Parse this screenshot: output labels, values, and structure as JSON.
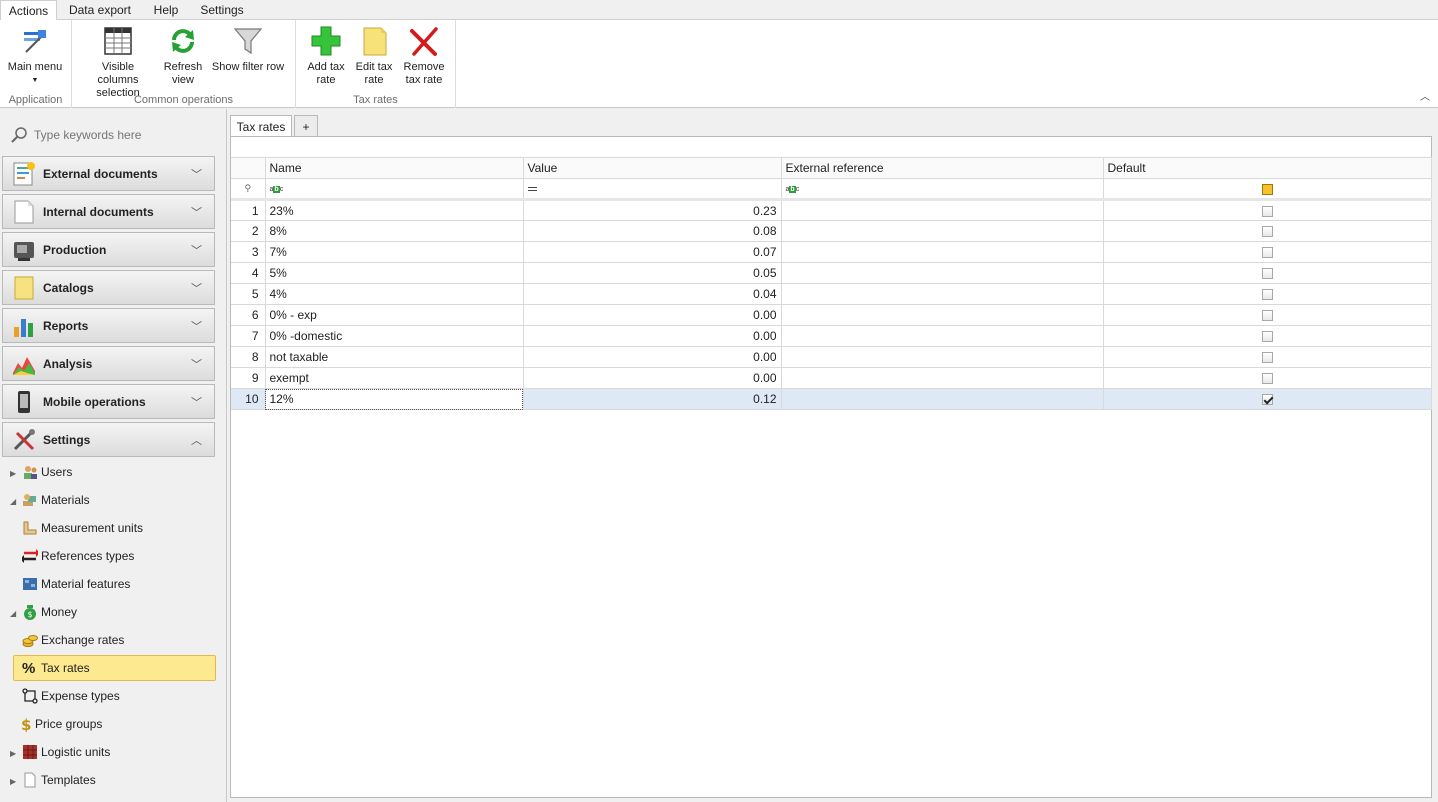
{
  "menu": {
    "tabs": [
      {
        "label": "Actions",
        "active": true
      },
      {
        "label": "Data export",
        "active": false
      },
      {
        "label": "Help",
        "active": false
      },
      {
        "label": "Settings",
        "active": false
      }
    ]
  },
  "ribbon": {
    "groups": [
      {
        "label": "Application",
        "buttons": [
          {
            "label": "Main menu",
            "icon": "main-menu-icon"
          }
        ]
      },
      {
        "label": "Common operations",
        "buttons": [
          {
            "label": "Visible columns selection",
            "icon": "columns-icon"
          },
          {
            "label": "Refresh view",
            "icon": "refresh-icon"
          },
          {
            "label": "Show filter row",
            "icon": "filter-icon"
          }
        ]
      },
      {
        "label": "Tax rates",
        "buttons": [
          {
            "label": "Add tax rate",
            "icon": "add-icon"
          },
          {
            "label": "Edit tax rate",
            "icon": "edit-icon"
          },
          {
            "label": "Remove tax rate",
            "icon": "remove-icon"
          }
        ]
      }
    ]
  },
  "sidebar": {
    "search_placeholder": "Type keywords here",
    "sections": [
      {
        "label": "External documents",
        "expanded": false
      },
      {
        "label": "Internal documents",
        "expanded": false
      },
      {
        "label": "Production",
        "expanded": false
      },
      {
        "label": "Catalogs",
        "expanded": false
      },
      {
        "label": "Reports",
        "expanded": false
      },
      {
        "label": "Analysis",
        "expanded": false
      },
      {
        "label": "Mobile operations",
        "expanded": false
      },
      {
        "label": "Settings",
        "expanded": true
      }
    ],
    "tree": [
      {
        "label": "Users",
        "icon": "users-icon"
      },
      {
        "label": "Materials",
        "icon": "materials-icon"
      },
      {
        "label": "Measurement units",
        "icon": "ruler-icon"
      },
      {
        "label": "References types",
        "icon": "arrows-icon"
      },
      {
        "label": "Material features",
        "icon": "features-icon"
      },
      {
        "label": "Money",
        "icon": "money-bag-icon"
      },
      {
        "label": "Exchange rates",
        "icon": "coins-icon"
      },
      {
        "label": "Tax rates",
        "icon": "percent-icon",
        "selected": true
      },
      {
        "label": "Expense types",
        "icon": "expense-icon"
      },
      {
        "label": "Price groups",
        "icon": "dollar-icon"
      },
      {
        "label": "Logistic units",
        "icon": "pallet-icon"
      },
      {
        "label": "Templates",
        "icon": "document-icon"
      }
    ]
  },
  "doc_tabs": [
    {
      "label": "Tax rates"
    },
    {
      "label": "+"
    }
  ],
  "grid": {
    "columns": [
      "Name",
      "Value",
      "External reference",
      "Default"
    ],
    "rows": [
      {
        "n": "1",
        "name": "23%",
        "value": "0.23",
        "ext": "",
        "default": false
      },
      {
        "n": "2",
        "name": "8%",
        "value": "0.08",
        "ext": "",
        "default": false
      },
      {
        "n": "3",
        "name": "7%",
        "value": "0.07",
        "ext": "",
        "default": false
      },
      {
        "n": "4",
        "name": "5%",
        "value": "0.05",
        "ext": "",
        "default": false
      },
      {
        "n": "5",
        "name": "4%",
        "value": "0.04",
        "ext": "",
        "default": false
      },
      {
        "n": "6",
        "name": "0% - exp",
        "value": "0.00",
        "ext": "",
        "default": false
      },
      {
        "n": "7",
        "name": "0% -domestic",
        "value": "0.00",
        "ext": "",
        "default": false
      },
      {
        "n": "8",
        "name": "not taxable",
        "value": "0.00",
        "ext": "",
        "default": false
      },
      {
        "n": "9",
        "name": "exempt",
        "value": "0.00",
        "ext": "",
        "default": false
      },
      {
        "n": "10",
        "name": "12%",
        "value": "0.12",
        "ext": "",
        "default": true
      }
    ]
  }
}
